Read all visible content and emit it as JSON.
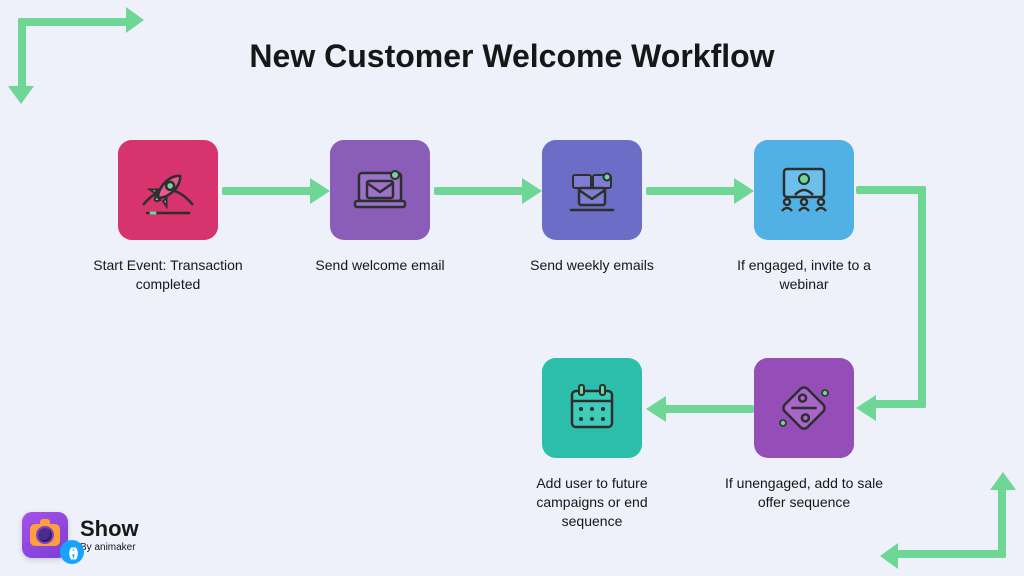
{
  "title": "New Customer Welcome Workflow",
  "steps": {
    "s1": {
      "label": "Start Event: Transaction completed"
    },
    "s2": {
      "label": "Send welcome email"
    },
    "s3": {
      "label": "Send weekly emails"
    },
    "s4": {
      "label": "If engaged, invite to a webinar"
    },
    "s5": {
      "label": "If unengaged, add to sale offer sequence"
    },
    "s6": {
      "label": "Add user to future campaigns or end sequence"
    }
  },
  "logo": {
    "brand": "Show",
    "byline": "By animaker"
  }
}
